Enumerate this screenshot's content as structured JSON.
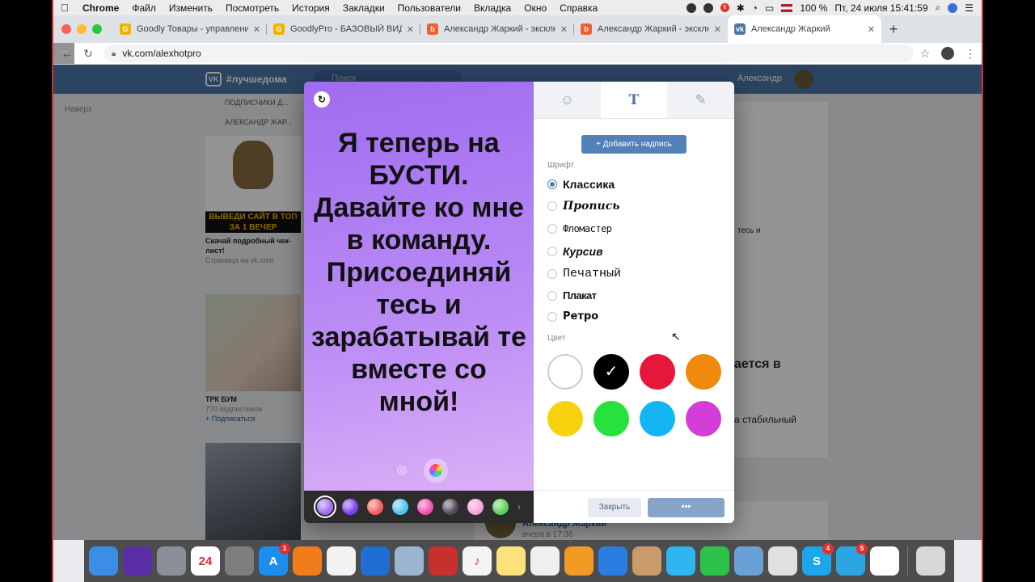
{
  "menubar": {
    "app": "Chrome",
    "items": [
      "Файл",
      "Изменить",
      "Посмотреть",
      "История",
      "Закладки",
      "Пользователи",
      "Вкладка",
      "Окно",
      "Справка"
    ],
    "notification_count": "6",
    "battery": "100 %",
    "datetime": "Пт, 24 июля  15:41:59"
  },
  "tabs": [
    {
      "title": "Goodly Товары - управление",
      "favicon": "G",
      "color": "#f0b400"
    },
    {
      "title": "GoodlyPro - БАЗОВЫЙ ВИДЕО",
      "favicon": "G",
      "color": "#f0b400"
    },
    {
      "title": "Александр Жаркий - эксклю",
      "favicon": "b",
      "color": "#f15f2c"
    },
    {
      "title": "Александр Жаркий - эксклю",
      "favicon": "b",
      "color": "#f15f2c"
    },
    {
      "title": "Александр Жаркий",
      "favicon": "vk",
      "color": "#4a76a8"
    }
  ],
  "address": {
    "url": "vk.com/alexhotpro"
  },
  "vk": {
    "hashtag": "#лучшедома",
    "search_placeholder": "Поиск",
    "user_name": "Александр",
    "back_to_top": "Наверх",
    "side_links": [
      "ПОДПИСЧИКИ Д...",
      "АЛЕКСАНДР ЖАР..."
    ],
    "cards": [
      {
        "title": "Скачай подробный чек-лист!",
        "sub": "Страница на vk.com",
        "link": "",
        "img_text": "ВЫВЕДИ САЙТ В ТОП ЗА 1 ВЕЧЕР"
      },
      {
        "title": "ТРК БУМ",
        "sub": "770 подписчиков",
        "link": "+ Подписаться",
        "img_text": ""
      }
    ],
    "ghost_texts": [
      "тесь и",
      "ается в",
      "а стабильный"
    ],
    "post": {
      "author": "Александр Жаркий",
      "date": "вчера в 17:36"
    }
  },
  "editor": {
    "story_text": "Я теперь на БУСТИ. Давайте ко мне в команду. Присоединяй тесь и зарабатывай те вместе со мной!",
    "add_label": "Добавить надпись",
    "font_label": "Шрифт",
    "fonts": [
      "Классика",
      "Пропись",
      "Фломастер",
      "Курсив",
      "Печатный",
      "Плакат",
      "Ретро"
    ],
    "selected_font": "Классика",
    "color_label": "Цвет",
    "colors": [
      "#ffffff",
      "#000000",
      "#e6173a",
      "#f2890f",
      "#f7d20f",
      "#27e23c",
      "#13b6f5",
      "#d43ed8"
    ],
    "selected_color": "#000000",
    "bg_swatches": [
      "#a06cf0",
      "#7b3ff0",
      "#f06060",
      "#4ec3f0",
      "#f04fb0",
      "#55465a",
      "#f8a0d8",
      "#5ad25a"
    ],
    "close_label": "Закрыть",
    "save_label": "•••"
  },
  "dock": {
    "apps": [
      {
        "name": "finder",
        "color": "#3a8ee6",
        "glyph": ""
      },
      {
        "name": "siri",
        "color": "#5a2ea6",
        "glyph": ""
      },
      {
        "name": "launchpad",
        "color": "#8a8f99",
        "glyph": ""
      },
      {
        "name": "calendar",
        "color": "#ffffff",
        "glyph": "24"
      },
      {
        "name": "system-preferences",
        "color": "#7d7d7d",
        "glyph": ""
      },
      {
        "name": "app-store",
        "color": "#1c8ef0",
        "glyph": "A",
        "badge": "1"
      },
      {
        "name": "books",
        "color": "#f07d1a",
        "glyph": ""
      },
      {
        "name": "photos",
        "color": "#f2f2f2",
        "glyph": ""
      },
      {
        "name": "screencast",
        "color": "#1e6fd1",
        "glyph": ""
      },
      {
        "name": "preview",
        "color": "#9bb5d0",
        "glyph": ""
      },
      {
        "name": "photo-booth",
        "color": "#c7302c",
        "glyph": ""
      },
      {
        "name": "music",
        "color": "#f4f4f4",
        "glyph": "♪"
      },
      {
        "name": "notes",
        "color": "#fbe27a",
        "glyph": ""
      },
      {
        "name": "textedit",
        "color": "#f0f0f0",
        "glyph": ""
      },
      {
        "name": "pages",
        "color": "#f29a24",
        "glyph": ""
      },
      {
        "name": "keynote",
        "color": "#2a7de1",
        "glyph": ""
      },
      {
        "name": "contacts",
        "color": "#c99a6a",
        "glyph": ""
      },
      {
        "name": "messages",
        "color": "#2fb5f0",
        "glyph": ""
      },
      {
        "name": "facetime",
        "color": "#2ec24b",
        "glyph": ""
      },
      {
        "name": "mail",
        "color": "#6aa0d8",
        "glyph": ""
      },
      {
        "name": "numbers",
        "color": "#e0e0e0",
        "glyph": ""
      },
      {
        "name": "skype",
        "color": "#1aa7ec",
        "glyph": "S",
        "badge": "4"
      },
      {
        "name": "telegram",
        "color": "#2ca5e0",
        "glyph": "",
        "badge": "5"
      },
      {
        "name": "chrome",
        "color": "#ffffff",
        "glyph": ""
      },
      {
        "name": "trash",
        "color": "#d8d8d8",
        "glyph": ""
      }
    ]
  }
}
